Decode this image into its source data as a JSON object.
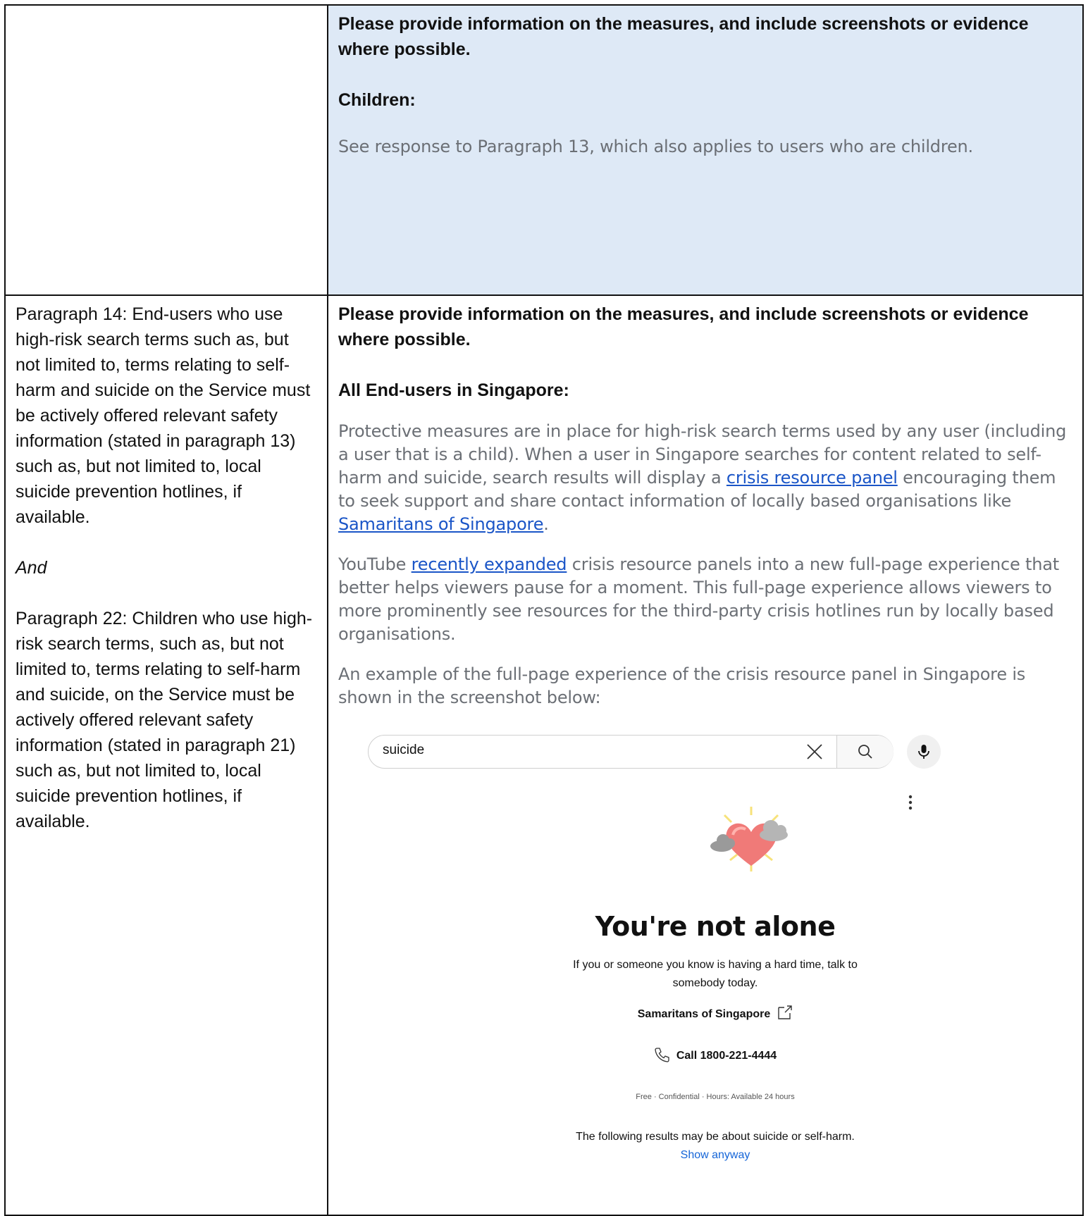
{
  "row1": {
    "question": "Please provide information on the measures, and include screenshots or evidence where possible.",
    "subheading": "Children:",
    "response": "See response to Paragraph 13, which also applies to users who are children."
  },
  "row2": {
    "left": {
      "para14": "Paragraph 14: End-users who use high-risk search terms such as, but not limited to, terms relating to self-harm and suicide on the Service must be actively offered relevant safety information (stated in paragraph 13) such as, but not limited to, local suicide prevention hotlines, if available.",
      "and": "And",
      "para22": "Paragraph 22: Children who use high-risk search terms, such as, but not limited to, terms relating to self-harm and suicide, on the Service must be actively offered relevant safety information (stated in paragraph 21) such as, but not limited to, local suicide prevention hotlines, if available."
    },
    "right": {
      "question": "Please provide information on the measures, and include screenshots or evidence where possible.",
      "subheading": "All End-users in Singapore:",
      "p1_a": "Protective measures are in place for high-risk search terms used by any user (including a user that is a child). When a user in Singapore searches for content related to self-harm and suicide, search results will display a ",
      "p1_link1": "crisis resource panel",
      "p1_b": " encouraging them to seek support and share contact information of locally based organisations like ",
      "p1_link2": "Samaritans of Singapore",
      "p1_c": ".",
      "p2_a": "YouTube ",
      "p2_link": "recently expanded",
      "p2_b": " crisis resource panels into a new full-page experience that better helps viewers pause for a moment. This full-page experience allows viewers to more prominently see resources for the third-party crisis hotlines run by locally based organisations.",
      "p3": "An example of the full-page experience of the crisis resource panel in Singapore is shown in the screenshot below:"
    }
  },
  "screenshot": {
    "search_value": "suicide",
    "title": "You're not alone",
    "subtitle_line1": "If you or someone you know is having a hard time, talk to",
    "subtitle_line2": "somebody today.",
    "org_name": "Samaritans of Singapore",
    "call_label": "Call 1800-221-4444",
    "hours": "Free · Confidential · Hours: Available 24 hours",
    "notice": "The following results may be about suicide or self-harm.",
    "show_anyway": "Show anyway"
  },
  "colors": {
    "shaded_cell": "#dee9f6",
    "link": "#1a55c7",
    "response_text": "#6b6f75"
  },
  "icons": [
    "clear-icon",
    "search-icon",
    "microphone-icon",
    "more-vert-icon",
    "heart-cloud-illustration",
    "external-link-icon",
    "phone-icon"
  ]
}
